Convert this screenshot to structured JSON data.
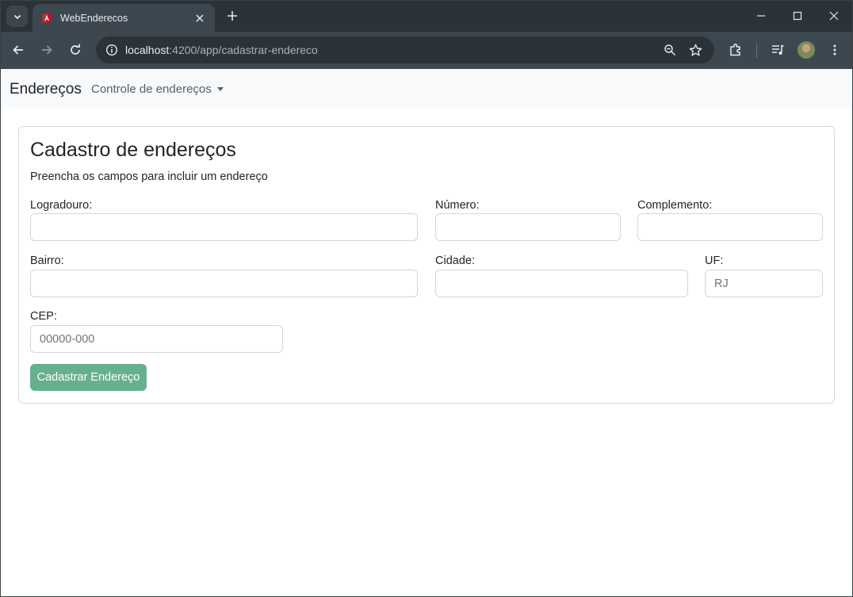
{
  "browser": {
    "tab_title": "WebEnderecos",
    "url_host": "localhost",
    "url_path": ":4200/app/cadastrar-endereco",
    "icons": [
      "tab-search-icon",
      "angular-favicon-icon",
      "close-icon",
      "plus-icon",
      "minimize-icon",
      "maximize-icon",
      "window-close-icon",
      "back-icon",
      "forward-icon",
      "reload-icon",
      "site-info-icon",
      "zoom-icon",
      "bookmark-star-icon",
      "extensions-icon",
      "media-queue-icon",
      "menu-dots-icon"
    ],
    "colors": {
      "tabstrip": "#2b3339",
      "toolbar": "#3c474f",
      "omnibox": "#2b3339"
    }
  },
  "navbar": {
    "brand": "Endereços",
    "dropdown_label": "Controle de endereços"
  },
  "form": {
    "title": "Cadastro de endereços",
    "subtitle": "Preencha os campos para incluir um endereço",
    "fields": {
      "logradouro": {
        "label": "Logradouro:",
        "value": "",
        "placeholder": ""
      },
      "numero": {
        "label": "Número:",
        "value": "",
        "placeholder": ""
      },
      "complemento": {
        "label": "Complemento:",
        "value": "",
        "placeholder": ""
      },
      "bairro": {
        "label": "Bairro:",
        "value": "",
        "placeholder": ""
      },
      "cidade": {
        "label": "Cidade:",
        "value": "",
        "placeholder": ""
      },
      "uf": {
        "label": "UF:",
        "value": "",
        "placeholder": "RJ"
      },
      "cep": {
        "label": "CEP:",
        "value": "",
        "placeholder": "00000-000"
      }
    },
    "submit_label": "Cadastrar Endereço",
    "submit_color": "#67b08f"
  }
}
